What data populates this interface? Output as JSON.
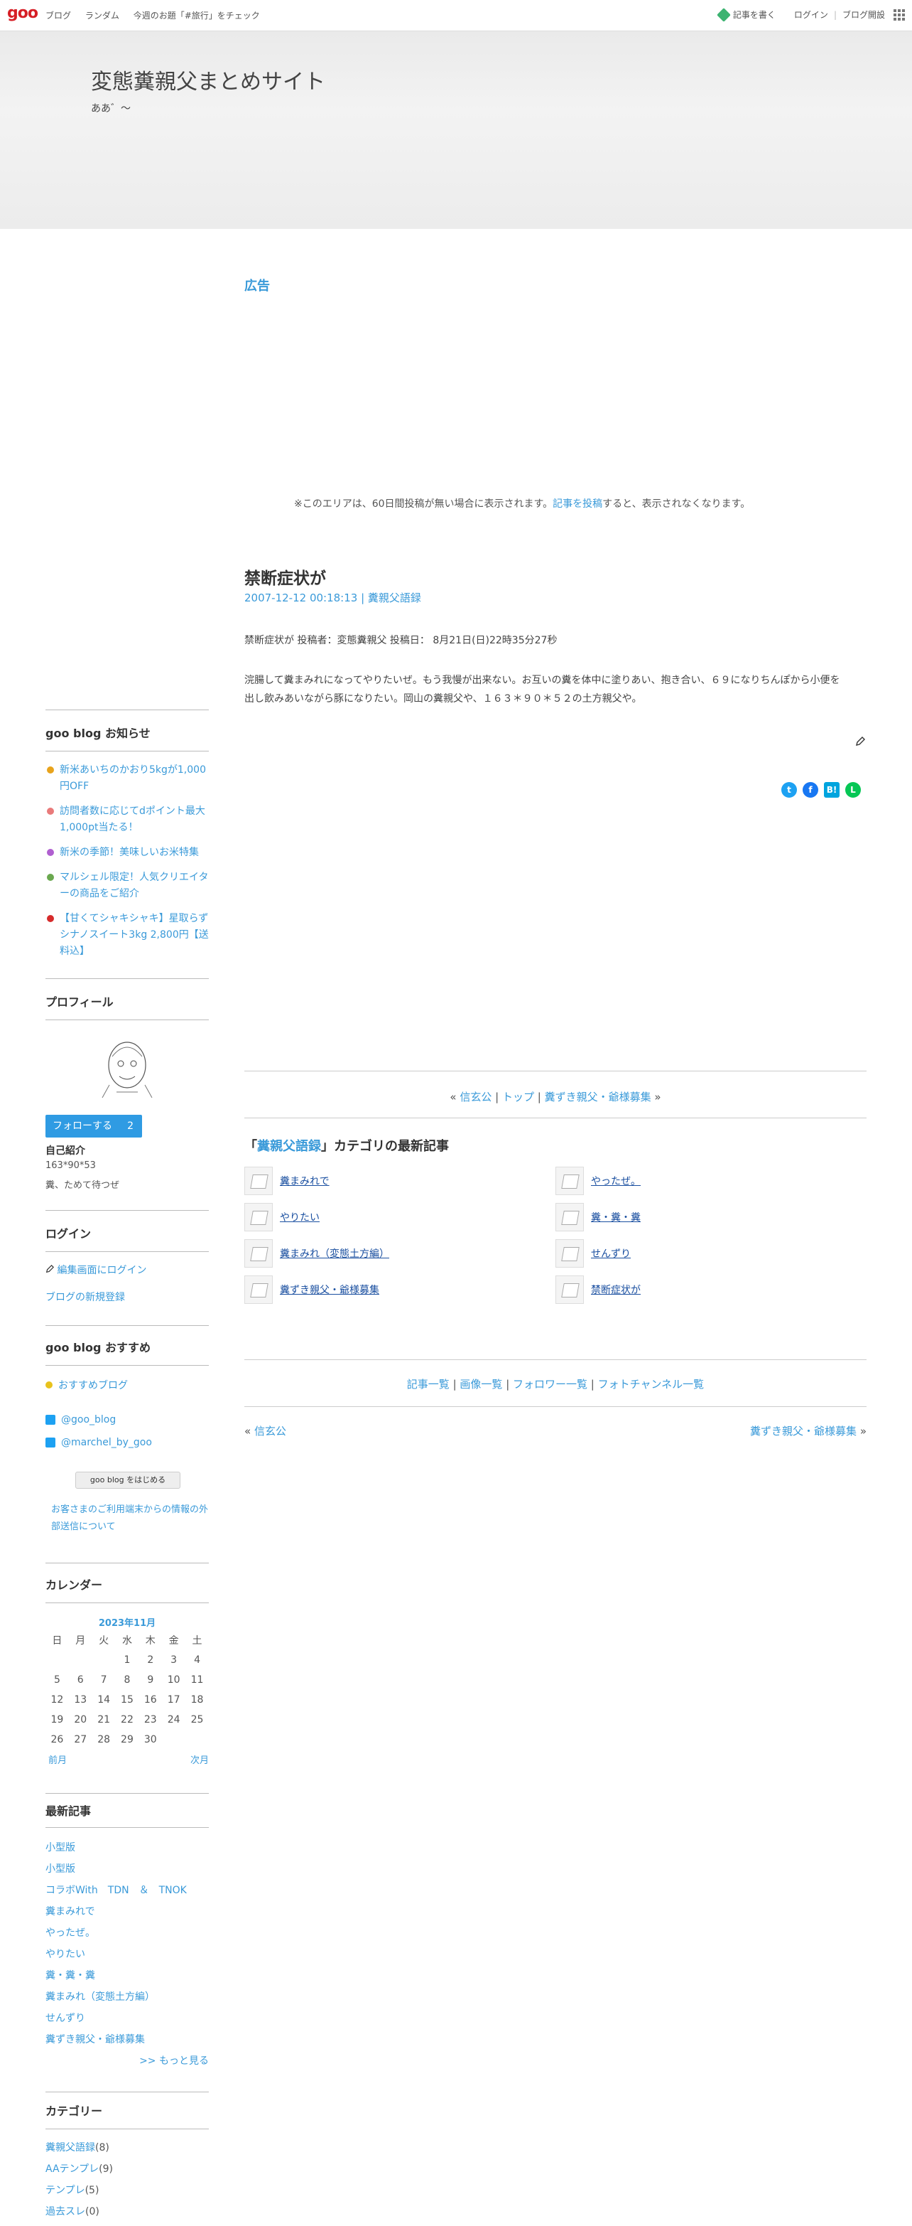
{
  "topbar": {
    "logo": "goo",
    "nav": [
      "ブログ",
      "ランダム",
      "今週のお題「#旅行」をチェック"
    ],
    "write": "記事を書く",
    "login": "ログイン",
    "open_blog": "ブログ開設"
  },
  "header": {
    "title": "変態糞親父まとめサイト",
    "subtitle": "ああ゛〜"
  },
  "ad": {
    "heading": "広告",
    "note_prefix": "※このエリアは、60日間投稿が無い場合に表示されます。",
    "note_link": "記事を投稿",
    "note_suffix": "すると、表示されなくなります。"
  },
  "entry": {
    "title": "禁断症状が",
    "meta": "2007-12-12 00:18:13 | 糞親父語録",
    "line1": "禁断症状が 投稿者：変態糞親父 投稿日： 8月21日(日)22時35分27秒",
    "body": "浣腸して糞まみれになってやりたいぜ。もう我慢が出来ない。お互いの糞を体中に塗りあい、抱き合い、６９になりちんぽから小便を出し飲みあいながら豚になりたい。岡山の糞親父や、１６３＊９０＊５２の土方親父や。"
  },
  "entry_nav": {
    "left_quote": "«",
    "prev": "信玄公",
    "top": "トップ",
    "next": "糞ずき親父・爺様募集",
    "right_quote": "»"
  },
  "category_recent": {
    "open_quote": "「",
    "name": "糞親父語録",
    "close_suffix": "」カテゴリの最新記事",
    "items": [
      "糞まみれで",
      "やったぜ。",
      "やりたい",
      "糞・糞・糞",
      "糞まみれ（変態土方編）",
      "せんずり",
      "糞ずき親父・爺様募集",
      "禁断症状が"
    ]
  },
  "footer_links": [
    "記事一覧",
    "画像一覧",
    "フォロワー一覧",
    "フォトチャンネル一覧"
  ],
  "pager": {
    "prev": "信玄公",
    "next": "糞ずき親父・爺様募集"
  },
  "sidebar": {
    "news_heading": "goo blog お知らせ",
    "news": [
      {
        "text": "新米あいちのかおり5kgが1,000円OFF",
        "icon": "rice-icon",
        "color": "#e8a31c"
      },
      {
        "text": "訪問者数に応じてdポイント最大1,000pt当たる！",
        "icon": "sparkle-icon",
        "color": "#e97a7a"
      },
      {
        "text": "新米の季節！美味しいお米特集",
        "icon": "music-note-icon",
        "color": "#b05fd0"
      },
      {
        "text": "マルシェル限定！人気クリエイターの商品をご紹介",
        "icon": "shop-icon",
        "color": "#6aa84f"
      },
      {
        "text": "【甘くてシャキシャキ】星取らずシナノスイート3kg 2,800円【送料込】",
        "icon": "apple-icon",
        "color": "#d62b2b"
      }
    ],
    "profile_heading": "プロフィール",
    "follow_label": "フォローする",
    "follow_count": "2",
    "intro_label": "自己紹介",
    "intro_stats": "163*90*53",
    "intro_text": "糞、ためて待つぜ",
    "login_heading": "ログイン",
    "login_edit": "編集画面にログイン",
    "login_new": "ブログの新規登録",
    "rec_heading": "goo blog おすすめ",
    "rec_blog": "おすすめブログ",
    "twitter1": "@goo_blog",
    "twitter2": "@marchel_by_goo",
    "start_button": "goo blog をはじめる",
    "privacy": "お客さまのご利用端末からの情報の外部送信について",
    "calendar_heading": "カレンダー",
    "calendar_month": "2023年11月",
    "calendar_days": [
      "日",
      "月",
      "火",
      "水",
      "木",
      "金",
      "土"
    ],
    "calendar_weeks": [
      [
        "",
        "",
        "",
        "1",
        "2",
        "3",
        "4"
      ],
      [
        "5",
        "6",
        "7",
        "8",
        "9",
        "10",
        "11"
      ],
      [
        "12",
        "13",
        "14",
        "15",
        "16",
        "17",
        "18"
      ],
      [
        "19",
        "20",
        "21",
        "22",
        "23",
        "24",
        "25"
      ],
      [
        "26",
        "27",
        "28",
        "29",
        "30",
        "",
        ""
      ]
    ],
    "calendar_prev": "前月",
    "calendar_next": "次月",
    "recent_heading": "最新記事",
    "recent": [
      "小型版",
      "小型版",
      "コラボWith　TDN　＆　TNOK",
      "糞まみれで",
      "やったぜ。",
      "やりたい",
      "糞・糞・糞",
      "糞まみれ（変態土方編）",
      "せんずり",
      "糞ずき親父・爺様募集"
    ],
    "more": ">> もっと見る",
    "cat_heading": "カテゴリー",
    "categories": [
      {
        "name": "糞親父語録",
        "count": "(8)"
      },
      {
        "name": "AAテンプレ",
        "count": "(9)"
      },
      {
        "name": "テンプレ",
        "count": "(5)"
      },
      {
        "name": "過去スレ",
        "count": "(0)"
      }
    ]
  },
  "colors": {
    "accent": "#3a9ad9",
    "follow": "#2f9be3",
    "logo": "#d61f26"
  }
}
